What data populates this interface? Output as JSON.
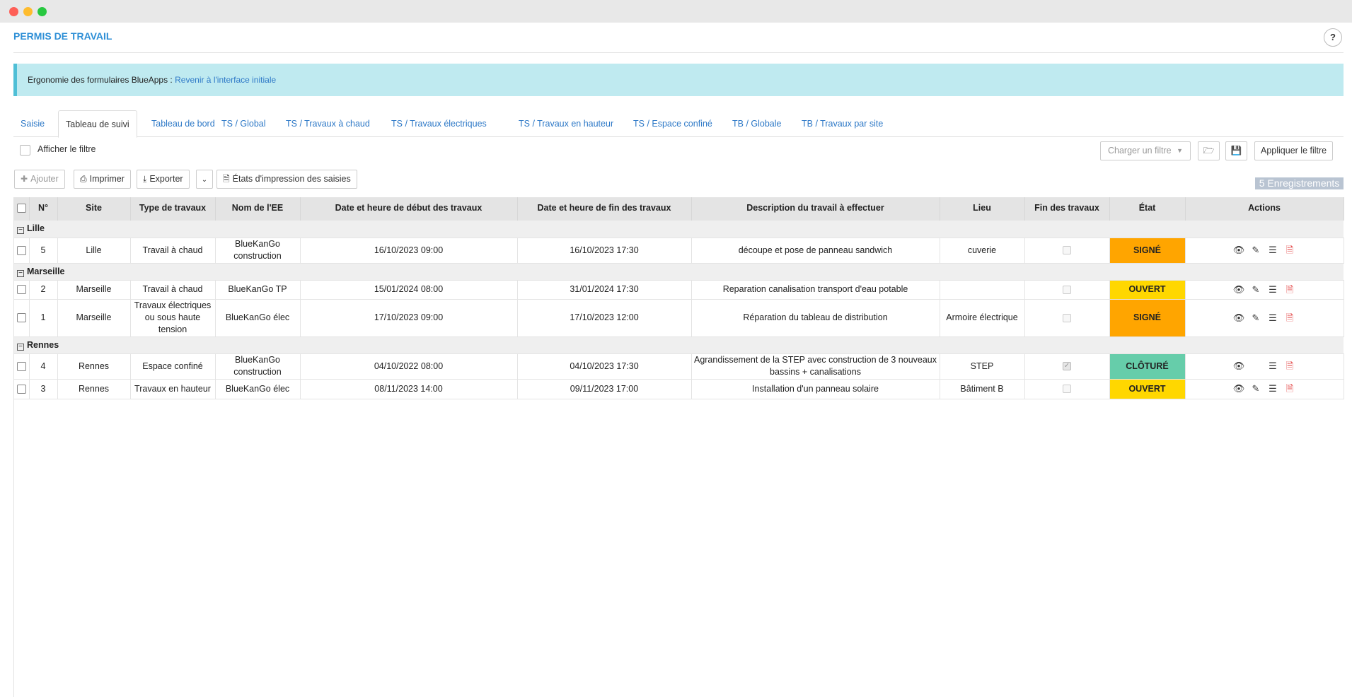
{
  "page": {
    "title": "PERMIS DE TRAVAIL",
    "help_label": "?"
  },
  "banner": {
    "text": "Ergonomie des formulaires BlueApps :",
    "link": "Revenir à l'interface initiale"
  },
  "tabs": [
    {
      "label": "Saisie"
    },
    {
      "label": "Tableau de suivi"
    },
    {
      "label": "Tableau de bord"
    },
    {
      "label": "TS / Global"
    },
    {
      "label": "TS / Travaux à chaud"
    },
    {
      "label": "TS / Travaux électriques"
    },
    {
      "label": "TS / Travaux en hauteur"
    },
    {
      "label": "TS / Espace confiné"
    },
    {
      "label": "TB / Globale"
    },
    {
      "label": "TB / Travaux par site"
    }
  ],
  "filter": {
    "show_label": "Afficher le filtre",
    "load_placeholder": "Charger un filtre",
    "apply_label": "Appliquer le filtre"
  },
  "toolbar": {
    "add_label": "Ajouter",
    "print_label": "Imprimer",
    "export_label": "Exporter",
    "print_states_label": "États d'impression des saisies"
  },
  "records_badge": "5 Enregistrements",
  "table": {
    "headers": [
      "N°",
      "Site",
      "Type de travaux",
      "Nom de l'EE",
      "Date et heure de début des travaux",
      "Date et heure de fin des travaux",
      "Description du travail à effectuer",
      "Lieu",
      "Fin des travaux",
      "État",
      "Actions"
    ],
    "groups": [
      {
        "name": "Lille",
        "rows": [
          {
            "num": "5",
            "site": "Lille",
            "type": "Travail à chaud",
            "ee": "BlueKanGo construction",
            "start": "16/10/2023 09:00",
            "end": "16/10/2023 17:30",
            "desc": "découpe et pose de panneau sandwich",
            "lieu": "cuverie",
            "status": "SIGNÉ"
          }
        ]
      },
      {
        "name": "Marseille",
        "rows": [
          {
            "num": "2",
            "site": "Marseille",
            "type": "Travail à chaud",
            "ee": "BlueKanGo TP",
            "start": "15/01/2024 08:00",
            "end": "31/01/2024 17:30",
            "desc": "Reparation canalisation transport d'eau potable",
            "lieu": "",
            "status": "OUVERT"
          },
          {
            "num": "1",
            "site": "Marseille",
            "type": "Travaux électriques ou sous haute tension",
            "ee": "BlueKanGo élec",
            "start": "17/10/2023 09:00",
            "end": "17/10/2023 12:00",
            "desc": "Réparation du tableau de distribution",
            "lieu": "Armoire électrique",
            "status": "SIGNÉ"
          }
        ]
      },
      {
        "name": "Rennes",
        "rows": [
          {
            "num": "4",
            "site": "Rennes",
            "type": "Espace confiné",
            "ee": "BlueKanGo construction",
            "start": "04/10/2022 08:00",
            "end": "04/10/2023 17:30",
            "desc": "Agrandissement de la STEP avec construction de 3 nouveaux bassins + canalisations",
            "lieu": "STEP",
            "status": "CLÔTURÉ"
          },
          {
            "num": "3",
            "site": "Rennes",
            "type": "Travaux en hauteur",
            "ee": "BlueKanGo élec",
            "start": "08/11/2023 14:00",
            "end": "09/11/2023 17:00",
            "desc": "Installation d'un panneau solaire",
            "lieu": "Bâtiment B",
            "status": "OUVERT"
          }
        ]
      }
    ]
  },
  "colors": {
    "accent": "#2e8fd6",
    "link": "#2e79c7",
    "banner_bg": "#bfeaf0",
    "status_signed": "#ffa500",
    "status_open": "#ffd700",
    "status_closed": "#66cdaa",
    "pdf_icon": "#e13b3b"
  },
  "icons": {
    "add": "plus-icon",
    "print": "printer-icon",
    "export": "download-icon",
    "print_states": "document-icon",
    "load_folder": "folder-open-icon",
    "save": "save-icon",
    "view": "eye-icon",
    "edit": "edit-icon",
    "menu": "list-icon",
    "pdf": "pdf-icon"
  }
}
